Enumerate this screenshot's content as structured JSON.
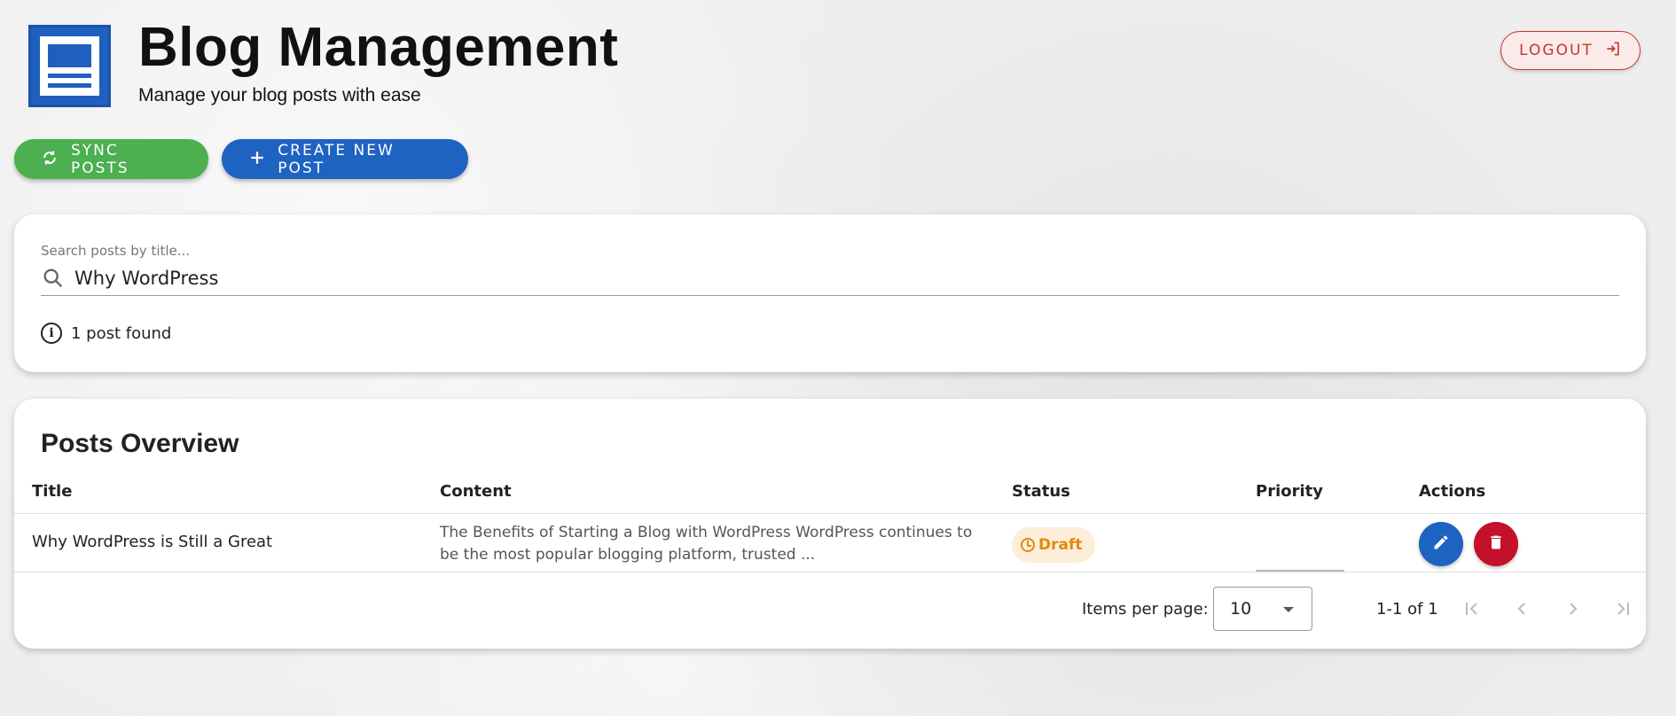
{
  "header": {
    "title": "Blog Management",
    "subtitle": "Manage your blog posts with ease",
    "logo_icon": "document-icon",
    "logout_label": "LOGOUT",
    "logout_icon": "login-arrow-icon"
  },
  "actions": {
    "sync_label": "SYNC POSTS",
    "sync_icon": "sync-icon",
    "create_label": "CREATE NEW POST",
    "create_icon": "plus-icon"
  },
  "search": {
    "placeholder": "Search posts by title...",
    "value": "Why WordPress",
    "results_text": "1 post found"
  },
  "posts": {
    "title": "Posts Overview",
    "columns": [
      "Title",
      "Content",
      "Status",
      "Priority",
      "Actions"
    ],
    "rows": [
      {
        "title": "Why WordPress is Still a Great",
        "content": "The Benefits of Starting a Blog with WordPress WordPress continues to be the most popular blogging platform, trusted ...",
        "status": "Draft",
        "priority": ""
      }
    ]
  },
  "pagination": {
    "items_per_page_label": "Items per page:",
    "items_per_page": "10",
    "range": "1-1 of 1"
  },
  "colors": {
    "primary": "#1f63c2",
    "success": "#4caf50",
    "danger": "#c4102a",
    "logout": "#c0392b",
    "draft": "#e08a10"
  }
}
